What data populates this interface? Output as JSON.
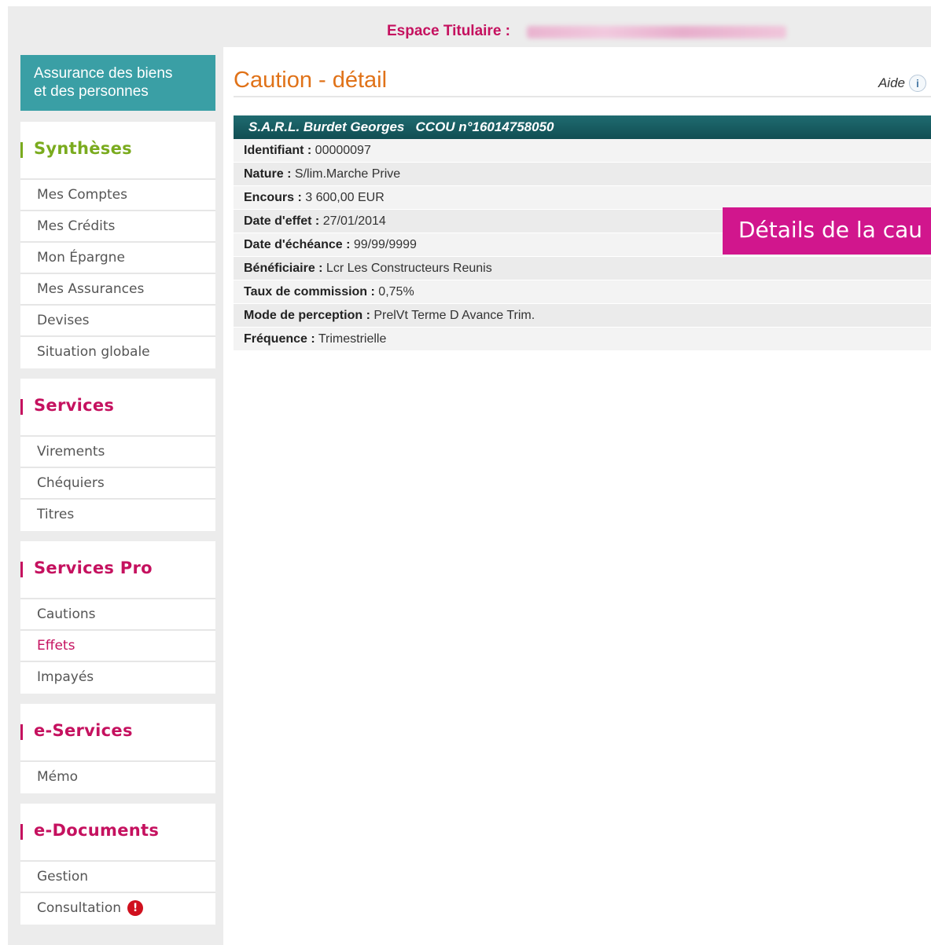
{
  "header": {
    "title": "Espace Titulaire :"
  },
  "sidebar": {
    "brand_line1": "Assurance des biens",
    "brand_line2": "et des personnes",
    "sections": {
      "syntheses": {
        "title": "Synthèses",
        "color": "#7aab1e",
        "items": [
          "Mes Comptes",
          "Mes Crédits",
          "Mon Épargne",
          "Mes Assurances",
          "Devises",
          "Situation globale"
        ]
      },
      "services": {
        "title": "Services",
        "color": "#c5115f",
        "items": [
          "Virements",
          "Chéquiers",
          "Titres"
        ]
      },
      "services_pro": {
        "title": "Services Pro",
        "color": "#c5115f",
        "items": [
          "Cautions",
          "Effets",
          "Impayés"
        ],
        "active_item": "Effets"
      },
      "e_services": {
        "title": "e-Services",
        "color": "#c5115f",
        "items": [
          "Mémo"
        ]
      },
      "e_documents": {
        "title": "e-Documents",
        "color": "#c5115f",
        "items": [
          "Gestion",
          "Consultation"
        ],
        "alert_icon": "!"
      }
    }
  },
  "main": {
    "title": "Caution - détail",
    "help_label": "Aide",
    "help_icon": "i",
    "table_header": "S.A.R.L. Burdet Georges   CCOU n°16014758050",
    "rows": [
      {
        "label": "Identifiant :",
        "value": " 00000097"
      },
      {
        "label": "Nature :",
        "value": " S/lim.Marche Prive"
      },
      {
        "label": "Encours :",
        "value": " 3 600,00  EUR"
      },
      {
        "label": "Date d'effet :",
        "value": " 27/01/2014"
      },
      {
        "label": "Date d'échéance :",
        "value": " 99/99/9999"
      },
      {
        "label": "Bénéficiaire :",
        "value": " Lcr Les Constructeurs Reunis"
      },
      {
        "label": "Taux de commission :",
        "value": " 0,75%"
      },
      {
        "label": "Mode de perception :",
        "value": " PrelVt Terme D Avance Trim."
      },
      {
        "label": "Fréquence :",
        "value": " Trimestrielle"
      }
    ]
  },
  "overlay_caption": "Détails de la cau",
  "colors": {
    "brand_teal": "#3a9fa5",
    "accent_pink": "#c5115f",
    "title_orange": "#e07218",
    "table_header": "#1f6b70",
    "caption_magenta": "#d1168d"
  }
}
